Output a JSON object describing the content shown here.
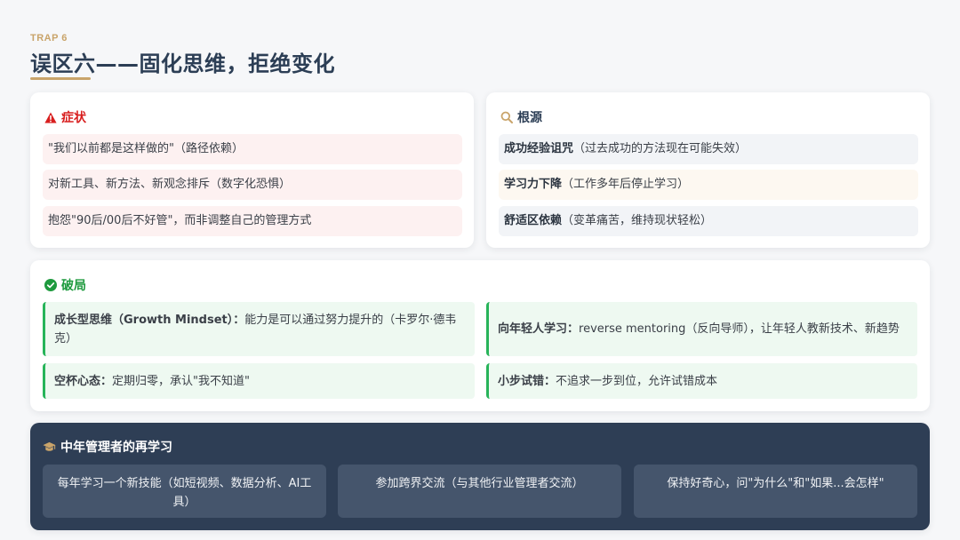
{
  "header": {
    "trap_label": "TRAP 6",
    "title": "误区六——固化思维，拒绝变化"
  },
  "colors": {
    "accent_gold": "#c9a46a",
    "symptom_red": "#d81e1e",
    "success_green": "#27b45a",
    "navy": "#2e3e55"
  },
  "symptoms": {
    "icon": "warning-triangle-icon",
    "title": "症状",
    "items": [
      "\"我们以前都是这样做的\"（路径依赖）",
      "对新工具、新方法、新观念排斥（数字化恐惧）",
      "抱怨\"90后/00后不好管\"，而非调整自己的管理方式"
    ]
  },
  "roots": {
    "icon": "magnifier-icon",
    "title": "根源",
    "items": [
      {
        "key": "成功经验诅咒",
        "text": "（过去成功的方法现在可能失效）"
      },
      {
        "key": "学习力下降",
        "text": "（工作多年后停止学习）"
      },
      {
        "key": "舒适区依赖",
        "text": "（变革痛苦，维持现状轻松）"
      }
    ]
  },
  "breakthrough": {
    "icon": "check-circle-icon",
    "title": "破局",
    "items": [
      {
        "key": "成长型思维（Growth Mindset）：",
        "text": "能力是可以通过努力提升的（卡罗尔·德韦克）"
      },
      {
        "key": "向年轻人学习：",
        "text": "reverse mentoring（反向导师），让年轻人教新技术、新趋势"
      },
      {
        "key": "空杯心态：",
        "text": "定期归零，承认\"我不知道\""
      },
      {
        "key": "小步试错：",
        "text": "不追求一步到位，允许试错成本"
      }
    ]
  },
  "relearn": {
    "icon": "graduation-cap-icon",
    "title": "中年管理者的再学习",
    "items": [
      "每年学习一个新技能（如短视频、数据分析、AI工具）",
      "参加跨界交流（与其他行业管理者交流）",
      "保持好奇心，问\"为什么\"和\"如果...会怎样\""
    ]
  }
}
